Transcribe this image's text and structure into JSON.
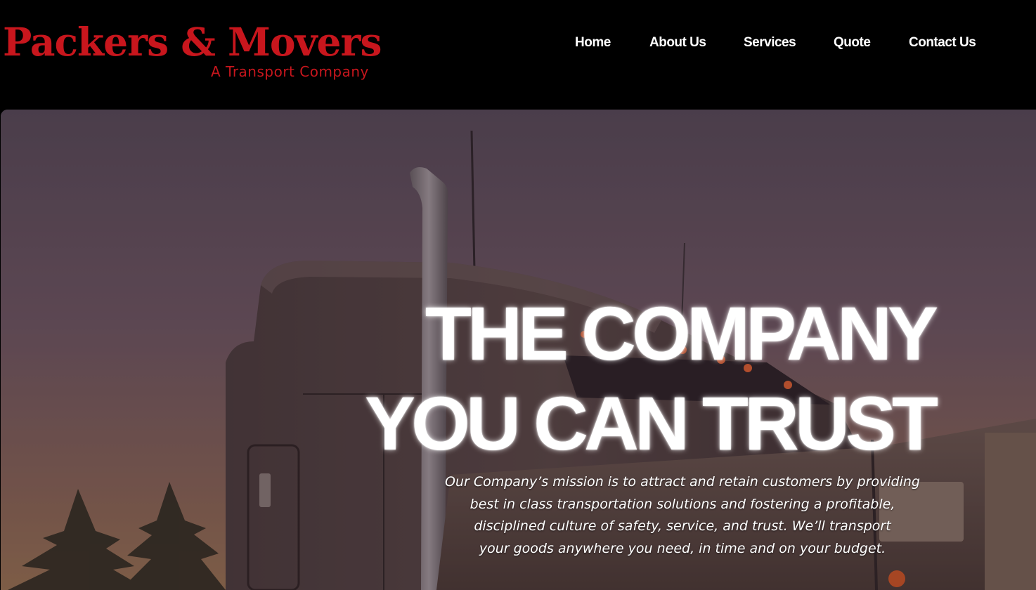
{
  "header": {
    "logo": {
      "title": "Packers & Movers",
      "tagline": "A Transport Company"
    },
    "nav": [
      {
        "label": "Home"
      },
      {
        "label": "About Us"
      },
      {
        "label": "Services"
      },
      {
        "label": "Quote"
      },
      {
        "label": "Contact Us"
      }
    ]
  },
  "hero": {
    "heading_line1": "THE COMPANY",
    "heading_line2": "YOU CAN TRUST",
    "description_lines": [
      "Our Company’s mission is to attract and retain customers by providing",
      "best in class transportation solutions and fostering a profitable,",
      "disciplined culture of safety, service, and trust. We’ll transport",
      "your goods anywhere you need, in time and on your budget."
    ],
    "image": "semi-truck-at-dusk"
  },
  "colors": {
    "brand_red": "#c8161d",
    "header_bg": "#000000",
    "text_white": "#ffffff"
  }
}
